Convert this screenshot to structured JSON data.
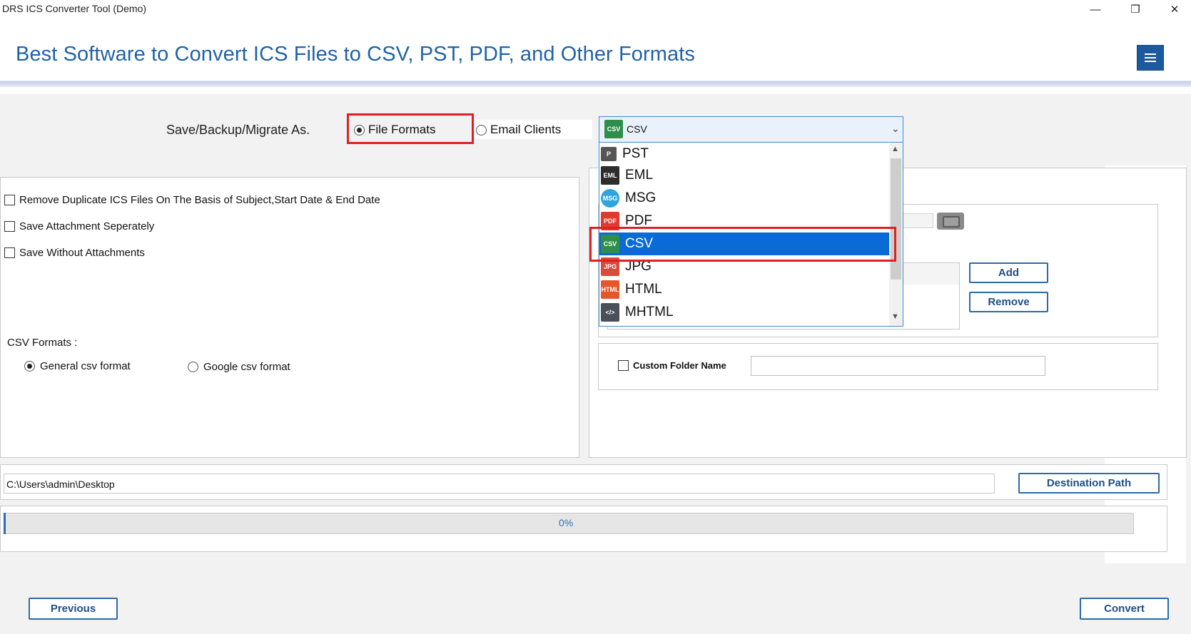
{
  "window": {
    "title": "DRS ICS Converter Tool (Demo)",
    "minimize": "—",
    "maximize": "❐",
    "close": "✕"
  },
  "header": {
    "heading": "Best Software to Convert ICS Files to CSV, PST, PDF, and Other Formats",
    "menu_icon": "hamburger-menu-icon"
  },
  "save_as": {
    "label": "Save/Backup/Migrate As.",
    "options": [
      "File Formats",
      "Email Clients"
    ],
    "selected": "File Formats"
  },
  "format_select": {
    "selected": "CSV",
    "options": [
      {
        "label": "PST",
        "icon": "pst-icon"
      },
      {
        "label": "EML",
        "icon": "eml-icon"
      },
      {
        "label": "MSG",
        "icon": "msg-icon"
      },
      {
        "label": "PDF",
        "icon": "pdf-icon"
      },
      {
        "label": "CSV",
        "icon": "csv-icon"
      },
      {
        "label": "JPG",
        "icon": "jpg-icon"
      },
      {
        "label": "HTML",
        "icon": "html-icon"
      },
      {
        "label": "MHTML",
        "icon": "mhtml-icon"
      }
    ],
    "highlighted": "CSV"
  },
  "options": {
    "remove_duplicates": "Remove Duplicate ICS Files On The Basis of Subject,Start Date & End Date",
    "save_attachment": "Save Attachment Seperately",
    "save_without": "Save Without Attachments"
  },
  "csv_formats": {
    "label": "CSV Formats :",
    "general": "General csv format",
    "google": "Google csv format",
    "selected": "General csv format"
  },
  "folder": {
    "add": "Add",
    "remove": "Remove",
    "custom_folder_label": "Custom Folder Name",
    "custom_folder_value": ""
  },
  "destination": {
    "path": "C:\\Users\\admin\\Desktop",
    "button": "Destination Path"
  },
  "progress": {
    "value": 0,
    "text": "0%"
  },
  "footer": {
    "previous": "Previous",
    "convert": "Convert"
  },
  "colors": {
    "accent": "#1f63a6",
    "selection": "#0a6ad7",
    "highlight_border": "#e01f25"
  }
}
